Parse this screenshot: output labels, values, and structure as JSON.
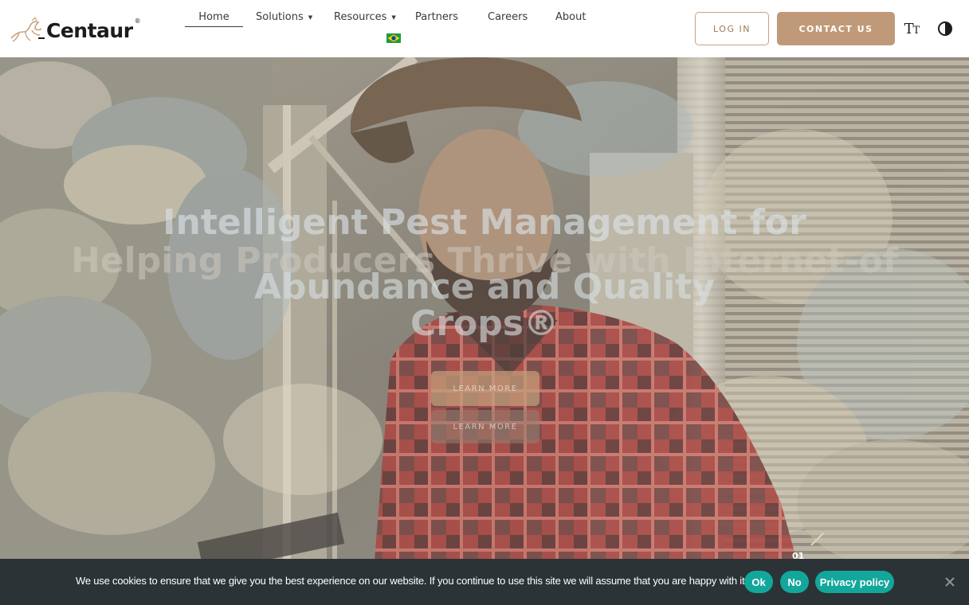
{
  "header": {
    "logo_text": "Centaur",
    "logo_reg": "®",
    "nav": [
      {
        "label": "Home",
        "active": true
      },
      {
        "label": "Solutions",
        "has_dropdown": true
      },
      {
        "label": "Resources",
        "has_dropdown": true
      },
      {
        "label": "Partners"
      },
      {
        "label": "Careers"
      },
      {
        "label": "About"
      }
    ],
    "login_label": "LOG IN",
    "contact_label": "CONTACT US",
    "text_size_icon": "text-size-icon",
    "contrast_icon": "contrast-icon",
    "accent_color": "#c09a78"
  },
  "hero": {
    "title_line_1": "Intelligent Pest Management for",
    "title_line_2": "Helping Producers Thrive with Internet-of",
    "title_line_3a": "Abundance and Quality",
    "title_line_3b": "Crops®",
    "button_1": "LEARN MORE",
    "button_2": "LEARN MORE",
    "slide_number": "01"
  },
  "cookie": {
    "text": "We use cookies to ensure that we give you the best experience on our website. If you continue to use this site we will assume that you are happy with it.",
    "ok_label": "Ok",
    "no_label": "No",
    "privacy_label": "Privacy policy",
    "button_color": "#13a79c"
  }
}
